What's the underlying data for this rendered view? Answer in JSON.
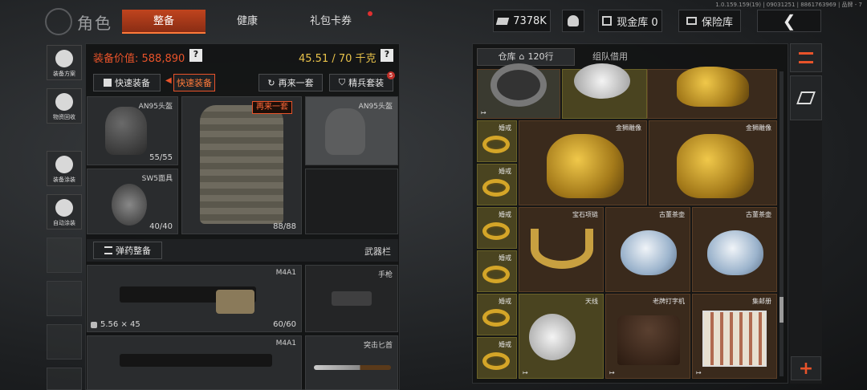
{
  "header": {
    "title": "角色",
    "tabs": [
      {
        "label": "整备",
        "active": true
      },
      {
        "label": "健康",
        "active": false
      },
      {
        "label": "礼包卡券",
        "active": false,
        "badge": true
      }
    ],
    "currency": "7378K",
    "cash_vault": "现金库 0",
    "safe_box": "保险库",
    "version": "1.0.159.159(19) | 09031251 | 8861763969 | 品牌 - 7",
    "back_icon": "chevron-left-icon"
  },
  "sidebar": {
    "items": [
      {
        "label": "装备方案",
        "icon": "loadout-icon"
      },
      {
        "label": "物资回收",
        "icon": "recycle-icon"
      },
      {
        "label": "装备涂装",
        "icon": "paint-icon"
      },
      {
        "label": "自动涂装",
        "icon": "auto-paint-icon"
      }
    ]
  },
  "equipment": {
    "value_label": "装备价值: 588,890",
    "weight": "45.51 / 70 千克",
    "help": "?",
    "quick_equip": "快速装备",
    "quick_equip_active": "快速装备",
    "again": "再来一套",
    "again_tooltip": "再来一套",
    "elite": "精兵套装",
    "elite_badge": "5",
    "slots": {
      "helmet": {
        "name": "AN95头盔",
        "count": "55/55"
      },
      "vest": {
        "count": "88/88"
      },
      "helmet2": {
        "name": "AN95头盔"
      },
      "mask": {
        "name": "SW5面具",
        "count": "40/40"
      }
    },
    "ammo_btn": "弹药整备",
    "weapon_bar": "武器栏",
    "weapons": [
      {
        "name": "M4A1",
        "ammo": "5.56 × 45",
        "count": "60/60"
      },
      {
        "name": "手枪"
      },
      {
        "name": "M4A1"
      },
      {
        "name": "突击匕首"
      }
    ]
  },
  "warehouse": {
    "tab_warehouse": "仓库",
    "tab_rows": "120行",
    "tab_team": "组队借用",
    "items": {
      "ring": "婚戒",
      "lion": "金狮雕像",
      "necklace": "宝石项链",
      "teapot": "古董茶壶",
      "antenna": "天线",
      "typewriter": "老牌打字机",
      "stamps": "集邮册"
    },
    "exit_mark": "↦"
  },
  "colors": {
    "accent": "#e8532a",
    "weight": "#e8c24a",
    "tab_active": "#c0441e"
  }
}
